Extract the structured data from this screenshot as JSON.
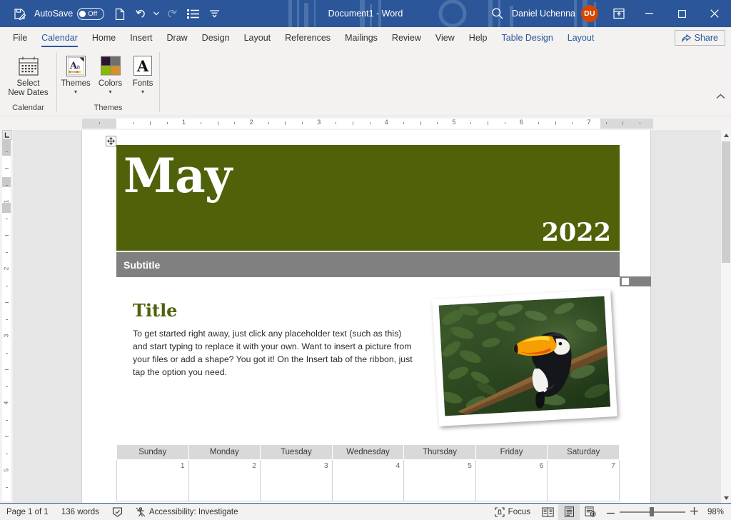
{
  "titlebar": {
    "autosave_label": "AutoSave",
    "autosave_state": "Off",
    "document_title": "Document1  -  Word",
    "account_name": "Daniel Uchenna",
    "account_initials": "DU",
    "icons": {
      "save": "save-icon",
      "new": "new-document-icon",
      "undo": "undo-icon",
      "undo_dropdown": "chevron-down-icon",
      "redo": "redo-icon",
      "list": "bullet-list-icon",
      "customize": "customize-quick-access-toolbar-icon",
      "search": "search-icon",
      "ribbon_display": "ribbon-display-options-icon",
      "minimize": "minimize-icon",
      "maximize": "maximize-icon",
      "close": "close-icon"
    },
    "accent_color": "#2b579a",
    "avatar_color": "#d64500"
  },
  "tabs": [
    {
      "label": "File",
      "active": false,
      "contextual": false
    },
    {
      "label": "Calendar",
      "active": true,
      "contextual": false
    },
    {
      "label": "Home",
      "active": false,
      "contextual": false
    },
    {
      "label": "Insert",
      "active": false,
      "contextual": false
    },
    {
      "label": "Draw",
      "active": false,
      "contextual": false
    },
    {
      "label": "Design",
      "active": false,
      "contextual": false
    },
    {
      "label": "Layout",
      "active": false,
      "contextual": false
    },
    {
      "label": "References",
      "active": false,
      "contextual": false
    },
    {
      "label": "Mailings",
      "active": false,
      "contextual": false
    },
    {
      "label": "Review",
      "active": false,
      "contextual": false
    },
    {
      "label": "View",
      "active": false,
      "contextual": false
    },
    {
      "label": "Help",
      "active": false,
      "contextual": false
    },
    {
      "label": "Table Design",
      "active": false,
      "contextual": true
    },
    {
      "label": "Layout",
      "active": false,
      "contextual": true
    }
  ],
  "share": {
    "label": "Share",
    "icon": "share-icon"
  },
  "ribbon": {
    "groups": [
      {
        "name": "Calendar",
        "label": "Calendar",
        "buttons": [
          {
            "label": "Select\nNew Dates",
            "label_line1": "Select",
            "label_line2": "New Dates",
            "icon": "calendar-icon",
            "has_dropdown": false
          }
        ]
      },
      {
        "name": "Themes",
        "label": "Themes",
        "buttons": [
          {
            "label": "Themes",
            "icon": "themes-icon",
            "has_dropdown": true
          },
          {
            "label": "Colors",
            "icon": "theme-colors-icon",
            "has_dropdown": true
          },
          {
            "label": "Fonts",
            "icon": "theme-fonts-icon",
            "has_dropdown": true
          }
        ]
      }
    ],
    "collapse_icon": "collapse-ribbon-icon"
  },
  "ruler": {
    "horizontal_numbers": [
      "1",
      "2",
      "3",
      "4",
      "5",
      "6",
      "7"
    ],
    "vertical_numbers": [
      "1",
      "2",
      "3",
      "4",
      "5"
    ],
    "tab_selector_icon": "left-tab-stop-icon"
  },
  "document": {
    "month": "May",
    "year": "2022",
    "subtitle": "Subtitle",
    "title": "Title",
    "body": "To get started right away, just click any placeholder text (such as this) and start typing to replace it with your own. Want to insert a picture from your files or add a shape? You got it! On the Insert tab of the ribbon, just tap the option you need.",
    "photo_alt": "toucan-photo",
    "banner_color": "#4f6209",
    "subtitle_bar_color": "#808080",
    "title_color": "#4f6209",
    "table_move_handle_icon": "table-move-handle-icon"
  },
  "calendar": {
    "headers": [
      "Sunday",
      "Monday",
      "Tuesday",
      "Wednesday",
      "Thursday",
      "Friday",
      "Saturday"
    ],
    "rows": [
      [
        "1",
        "2",
        "3",
        "4",
        "5",
        "6",
        "7"
      ]
    ]
  },
  "statusbar": {
    "page": "Page 1 of 1",
    "words": "136 words",
    "proofing_icon": "proofing-errors-icon",
    "accessibility": "Accessibility: Investigate",
    "accessibility_icon": "accessibility-icon",
    "focus": "Focus",
    "focus_icon": "focus-mode-icon",
    "view_read_icon": "read-mode-icon",
    "view_print_icon": "print-layout-icon",
    "view_web_icon": "web-layout-icon",
    "zoom": "98%",
    "zoom_out_icon": "zoom-out-icon",
    "zoom_in_icon": "zoom-in-icon"
  }
}
